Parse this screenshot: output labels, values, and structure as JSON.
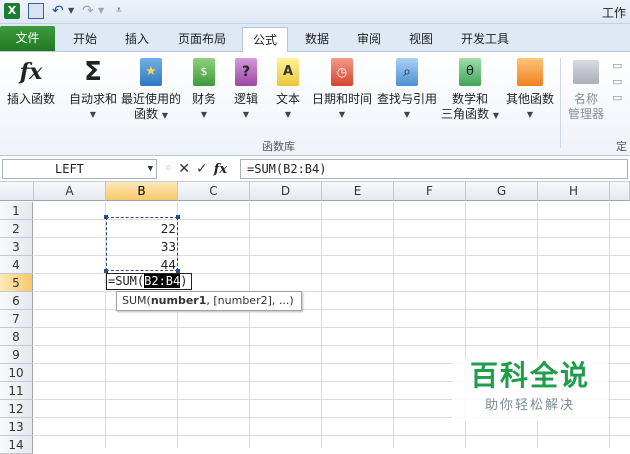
{
  "window": {
    "title": "工作"
  },
  "tabs": [
    {
      "label": "文件"
    },
    {
      "label": "开始"
    },
    {
      "label": "插入"
    },
    {
      "label": "页面布局"
    },
    {
      "label": "公式"
    },
    {
      "label": "数据"
    },
    {
      "label": "审阅"
    },
    {
      "label": "视图"
    },
    {
      "label": "开发工具"
    }
  ],
  "ribbon": {
    "insert_function": "插入函数",
    "autosum": "自动求和",
    "recent_1": "最近使用的",
    "recent_2": "函数",
    "financial": "财务",
    "logical": "逻辑",
    "text": "文本",
    "datetime": "日期和时间",
    "lookup": "查找与引用",
    "math_1": "数学和",
    "math_2": "三角函数",
    "other": "其他函数",
    "name_mgr_1": "名称",
    "name_mgr_2": "管理器",
    "group_label": "函数库",
    "group_label_2": "定"
  },
  "formula_bar": {
    "name_box": "LEFT",
    "formula": "=SUM(B2:B4)"
  },
  "columns": [
    "A",
    "B",
    "C",
    "D",
    "E",
    "F",
    "G",
    "H"
  ],
  "rows": [
    "1",
    "2",
    "3",
    "4",
    "5",
    "6",
    "7",
    "8",
    "9",
    "10",
    "11",
    "12",
    "13",
    "14"
  ],
  "cells": {
    "b2": "22",
    "b3": "33",
    "b4": "44"
  },
  "edit": {
    "prefix": "=SUM(",
    "highlight": "B2:B4",
    "suffix": ")"
  },
  "tooltip": {
    "fn": "SUM(",
    "arg1": "number1",
    "rest": ", [number2], ...)"
  },
  "watermark": {
    "line1": "百科全说",
    "line2": "助你轻松解决"
  },
  "colors": {
    "file_tab": "#2a8a2d",
    "selection_header": "#f7c86a",
    "marquee": "#2a4d86"
  }
}
